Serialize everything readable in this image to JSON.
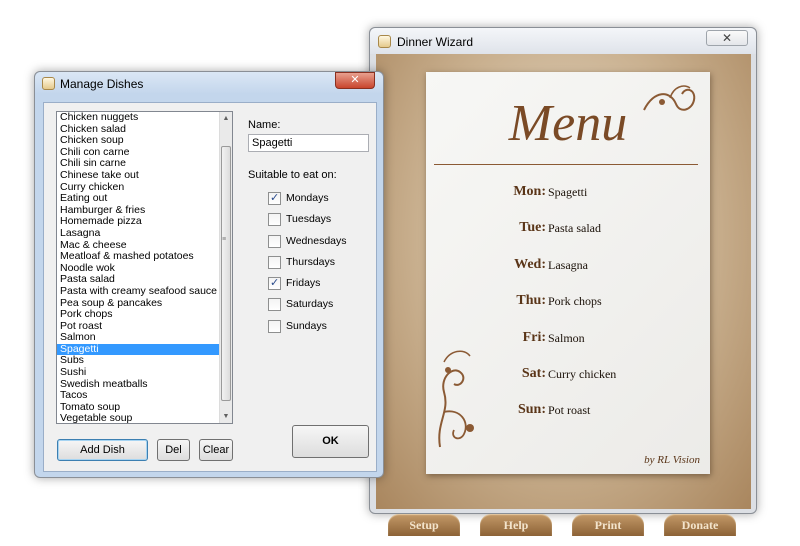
{
  "dinner_wizard": {
    "title": "Dinner Wizard",
    "close_label": "✕",
    "menu_title": "Menu",
    "byline": "by RL Vision",
    "days": [
      {
        "day": "Mon:",
        "dish": "Spagetti"
      },
      {
        "day": "Tue:",
        "dish": "Pasta salad"
      },
      {
        "day": "Wed:",
        "dish": "Lasagna"
      },
      {
        "day": "Thu:",
        "dish": "Pork chops"
      },
      {
        "day": "Fri:",
        "dish": "Salmon"
      },
      {
        "day": "Sat:",
        "dish": "Curry chicken"
      },
      {
        "day": "Sun:",
        "dish": "Pot roast"
      }
    ],
    "buttons": {
      "setup": "Setup",
      "help": "Help",
      "print": "Print",
      "donate": "Donate"
    }
  },
  "manage_dishes": {
    "title": "Manage Dishes",
    "close_label": "✕",
    "dishes": [
      "Chicken nuggets",
      "Chicken salad",
      "Chicken soup",
      "Chili con carne",
      "Chili sin carne",
      "Chinese take out",
      "Curry chicken",
      "Eating out",
      "Hamburger & fries",
      "Homemade pizza",
      "Lasagna",
      "Mac & cheese",
      "Meatloaf & mashed potatoes",
      "Noodle wok",
      "Pasta salad",
      "Pasta with creamy seafood sauce",
      "Pea soup & pancakes",
      "Pork chops",
      "Pot roast",
      "Salmon",
      "Spagetti",
      "Subs",
      "Sushi",
      "Swedish meatballs",
      "Tacos",
      "Tomato soup",
      "Vegetable soup"
    ],
    "selected_dish": "Spagetti",
    "name_label": "Name:",
    "name_value": "Spagetti",
    "suitable_label": "Suitable to eat on:",
    "days": [
      {
        "label": "Mondays",
        "checked": true
      },
      {
        "label": "Tuesdays",
        "checked": false
      },
      {
        "label": "Wednesdays",
        "checked": false
      },
      {
        "label": "Thursdays",
        "checked": false
      },
      {
        "label": "Fridays",
        "checked": true
      },
      {
        "label": "Saturdays",
        "checked": false
      },
      {
        "label": "Sundays",
        "checked": false
      }
    ],
    "buttons": {
      "add": "Add Dish",
      "del": "Del",
      "clear": "Clear",
      "ok": "OK"
    }
  }
}
